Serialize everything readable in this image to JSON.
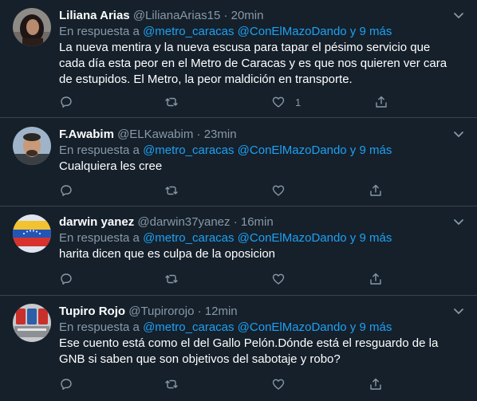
{
  "reply_prefix": "En respuesta a",
  "separator": "·",
  "tweets": [
    {
      "name": "Liliana Arias",
      "handle": "@LilianaArias15",
      "time": "20min",
      "mentions": "@metro_caracas @ConElMazoDando y 9 más",
      "text_lines": [
        "La nueva mentira y la nueva escusa para tapar el pésimo servicio que",
        "cada día esta peor en el Metro de Caracas y es que nos quieren ver cara",
        "de estupidos. El Metro, la peor maldición en transporte."
      ],
      "likes": "1"
    },
    {
      "name": "F.Awabim",
      "handle": "@ELKawabim",
      "time": "23min",
      "mentions": "@metro_caracas @ConElMazoDando y 9 más",
      "text_lines": [
        "Cualquiera les cree"
      ],
      "likes": ""
    },
    {
      "name": "darwin yanez",
      "handle": "@darwin37yanez",
      "time": "16min",
      "mentions": "@metro_caracas @ConElMazoDando y 9 más",
      "text_lines": [
        "harita dicen que es culpa de la oposicion"
      ],
      "likes": ""
    },
    {
      "name": "Tupiro Rojo",
      "handle": "@Tupirorojo",
      "time": "12min",
      "mentions": "@metro_caracas @ConElMazoDando y 9 más",
      "text_lines": [
        "Ese cuento está como el del Gallo Pelón.Dónde está el resguardo de la",
        "GNB si saben que son objetivos del sabotaje y robo?"
      ],
      "likes": ""
    }
  ]
}
